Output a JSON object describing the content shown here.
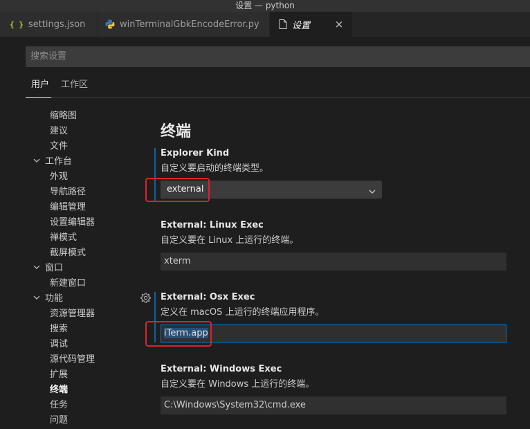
{
  "window": {
    "title": "设置 — python"
  },
  "tabs": [
    {
      "label": "settings.json",
      "icon": "json-icon"
    },
    {
      "label": "winTerminalGbkEncodeError.py",
      "icon": "python-icon"
    },
    {
      "label": "设置",
      "icon": "file-icon",
      "close": "×"
    }
  ],
  "search": {
    "placeholder": "搜索设置"
  },
  "scope_tabs": [
    "用户",
    "工作区"
  ],
  "toc": [
    {
      "label": "缩略图",
      "indent": 2
    },
    {
      "label": "建议",
      "indent": 2
    },
    {
      "label": "文件",
      "indent": 2
    },
    {
      "label": "工作台",
      "indent": 1,
      "expanded": true
    },
    {
      "label": "外观",
      "indent": 2
    },
    {
      "label": "导航路径",
      "indent": 2
    },
    {
      "label": "编辑管理",
      "indent": 2
    },
    {
      "label": "设置编辑器",
      "indent": 2
    },
    {
      "label": "禅模式",
      "indent": 2
    },
    {
      "label": "截屏模式",
      "indent": 2
    },
    {
      "label": "窗口",
      "indent": 1,
      "expanded": true
    },
    {
      "label": "新建窗口",
      "indent": 2
    },
    {
      "label": "功能",
      "indent": 1,
      "expanded": true
    },
    {
      "label": "资源管理器",
      "indent": 2
    },
    {
      "label": "搜索",
      "indent": 2
    },
    {
      "label": "调试",
      "indent": 2
    },
    {
      "label": "源代码管理",
      "indent": 2
    },
    {
      "label": "扩展",
      "indent": 2
    },
    {
      "label": "终端",
      "indent": 2,
      "active": true
    },
    {
      "label": "任务",
      "indent": 2
    },
    {
      "label": "问题",
      "indent": 2
    }
  ],
  "section": {
    "title": "终端"
  },
  "settings": {
    "explorer_kind": {
      "name": "Explorer Kind",
      "description": "自定义要启动的终端类型。",
      "value": "external"
    },
    "linux_exec": {
      "category": "External: ",
      "name": "Linux Exec",
      "description": "自定义要在 Linux 上运行的终端。",
      "value": "xterm"
    },
    "osx_exec": {
      "category": "External: ",
      "name": "Osx Exec",
      "description": "定义在 macOS 上运行的终端应用程序。",
      "value": "iTerm.app"
    },
    "windows_exec": {
      "category": "External: ",
      "name": "Windows Exec",
      "description": "自定义要在 Windows 上运行的终端。",
      "value": "C:\\Windows\\System32\\cmd.exe"
    }
  },
  "colors": {
    "accent": "#007fd4",
    "highlight": "#e0202c",
    "background": "#1e1e1e"
  }
}
